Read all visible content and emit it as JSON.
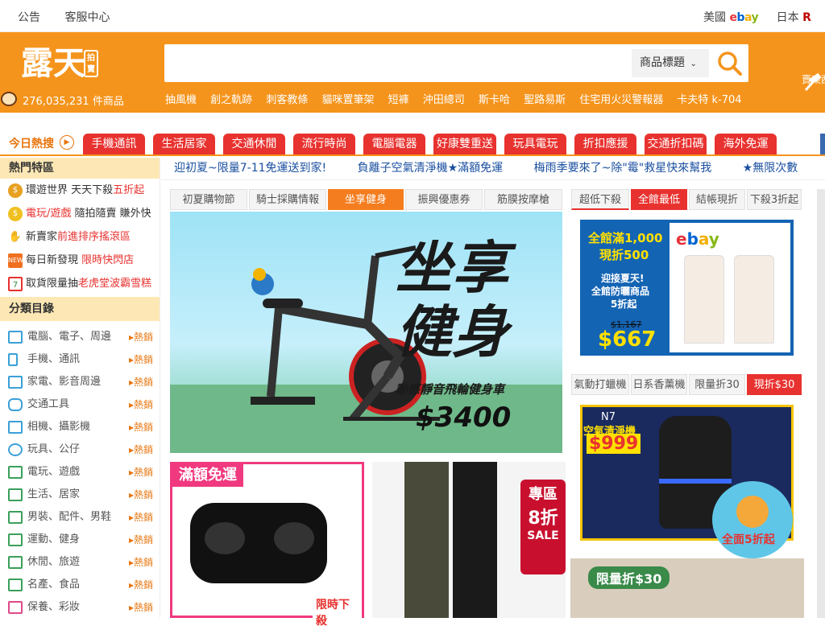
{
  "topbar": {
    "links": [
      "公告",
      "客服中心"
    ],
    "us": "美國",
    "ebay": "ebay",
    "jp": "日本"
  },
  "header": {
    "logo": "露天",
    "logo_seal": "拍賣",
    "item_count": "276,035,231 件商品",
    "search": {
      "placeholder": "",
      "scope": "商品標題"
    },
    "hot_keywords": [
      "抽風機",
      "創之軌跡",
      "刺客教條",
      "貓咪置筆架",
      "短褲",
      "沖田總司",
      "斯卡哈",
      "聖路易斯",
      "住宅用火災警報器",
      "卡夫特 k-704"
    ],
    "cart_label": "賣東西"
  },
  "hot_tabs": {
    "label": "今日熱搜",
    "items": [
      "手機通訊",
      "生活居家",
      "交通休閒",
      "流行時尚",
      "電腦電器",
      "好康雙重送",
      "玩具電玩",
      "折扣應援",
      "交通折扣碼",
      "海外免運"
    ]
  },
  "sidebar": {
    "hot_title": "熱門特區",
    "promos": [
      {
        "a": "環遊世界 天天下殺",
        "b": "五折起"
      },
      {
        "a": "電玩/遊戲",
        "b": "隨拍隨賣 賺外快"
      },
      {
        "a": "新賣家",
        "b": "前進排序搖滾區"
      },
      {
        "a": "每日新發現",
        "b": "限時快閃店"
      },
      {
        "a": "取貨限量抽",
        "b": "老虎堂波霸雪糕"
      }
    ],
    "cat_title": "分類目錄",
    "hot_label": "熱銷",
    "categories": [
      "電腦、電子、周邊",
      "手機、通訊",
      "家電、影音周邊",
      "交通工具",
      "相機、攝影機",
      "玩具、公仔",
      "電玩、遊戲",
      "生活、居家",
      "男裝、配件、男鞋",
      "運動、健身",
      "休閒、旅遊",
      "名產、食品",
      "保養、彩妝"
    ]
  },
  "marquee": [
    "迎初夏~限量7-11免運送到家!",
    "負離子空氣清淨機★滿額免運",
    "梅雨季要來了~除\"霉\"救星快來幫我",
    "★無限次數"
  ],
  "banner_tabs": [
    "初夏購物節",
    "騎士採購情報",
    "坐享健身",
    "振興優惠券",
    "筋膜按摩槍"
  ],
  "main_banner": {
    "h1": "坐享",
    "h2": "健身",
    "sub": "動感靜音飛輪健身車",
    "price": "$3400"
  },
  "side_tabs1": [
    "超低下殺",
    "全館最低",
    "結帳現折",
    "下殺3折起"
  ],
  "side_tabs2": [
    "氣動打蠟機",
    "日系香薰機",
    "限量折30",
    "現折$30"
  ],
  "ad1": {
    "t1": "全館滿1,000",
    "t2": "現折500",
    "t3": "迎接夏天!",
    "t4": "全館防曬商品",
    "t5": "5折起",
    "old": "$1,167",
    "price": "$667",
    "brand": "ebay"
  },
  "ad2": {
    "model": "N7",
    "name": "空氣清淨機",
    "price": "$999",
    "badge": "全面5折起"
  },
  "ad3": {
    "title": "滿額免運",
    "tag": "限時下殺"
  },
  "ad4": {
    "zone": "專區",
    "off": "8折",
    "sale": "SALE"
  },
  "ad5": {
    "title": "限量折$30"
  }
}
